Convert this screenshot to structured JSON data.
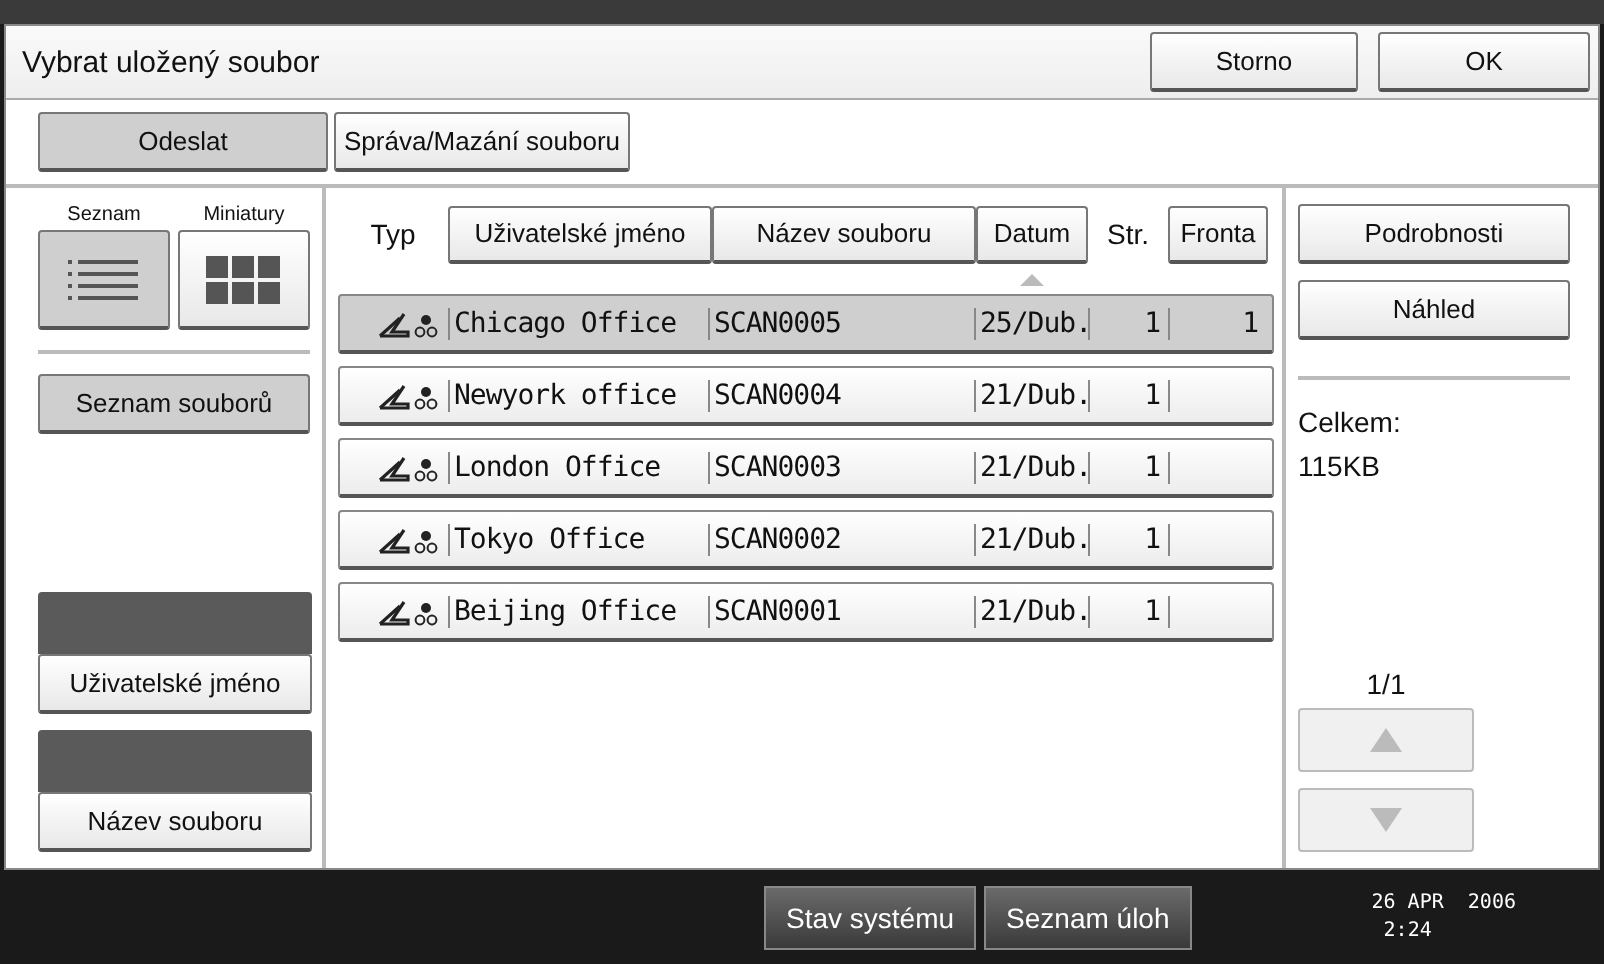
{
  "title": "Vybrat uložený soubor",
  "header_buttons": [
    "Storno",
    "OK"
  ],
  "tabs": [
    {
      "label": "Odeslat",
      "selected": true
    },
    {
      "label": "Správa/Mazání souboru",
      "selected": false
    }
  ],
  "view_modes": [
    {
      "label": "Seznam",
      "kind": "list",
      "selected": true
    },
    {
      "label": "Miniatury",
      "kind": "grid",
      "selected": false
    }
  ],
  "file_list_button": {
    "label": "Seznam souborů",
    "selected": true
  },
  "search_buttons": [
    "Uživatelské jméno",
    "Název souboru"
  ],
  "columns": [
    {
      "label": "Typ",
      "kind": "text",
      "sorted": false
    },
    {
      "label": "Uživatelské jméno",
      "kind": "button",
      "sorted": false
    },
    {
      "label": "Název souboru",
      "kind": "button",
      "sorted": false
    },
    {
      "label": "Datum",
      "kind": "button",
      "sorted": true
    },
    {
      "label": "Str.",
      "kind": "text",
      "sorted": false
    },
    {
      "label": "Fronta",
      "kind": "button",
      "sorted": false
    }
  ],
  "rows": [
    {
      "user": "Chicago Office",
      "file": "SCAN0005",
      "date": "25/Dub.",
      "pages": "1",
      "queue": "1",
      "selected": true
    },
    {
      "user": "Newyork office",
      "file": "SCAN0004",
      "date": "21/Dub.",
      "pages": "1",
      "selected": false
    },
    {
      "user": "London Office",
      "file": "SCAN0003",
      "date": "21/Dub.",
      "pages": "1",
      "selected": false
    },
    {
      "user": "Tokyo Office",
      "file": "SCAN0002",
      "date": "21/Dub.",
      "pages": "1",
      "selected": false
    },
    {
      "user": "Beijing Office",
      "file": "SCAN0001",
      "date": "21/Dub.",
      "pages": "1",
      "selected": false
    }
  ],
  "side_buttons": [
    "Podrobnosti",
    "Náhled"
  ],
  "total_label": "Celkem:",
  "total": "115KB",
  "page": "1/1",
  "scroll_buttons": [
    {
      "kind": "up",
      "disabled": true
    },
    {
      "kind": "down",
      "disabled": true
    }
  ],
  "status_bar": {
    "buttons": [
      "Stav systému",
      "Seznam úloh"
    ],
    "date": "26 APR  2006",
    "time": "2:24"
  }
}
